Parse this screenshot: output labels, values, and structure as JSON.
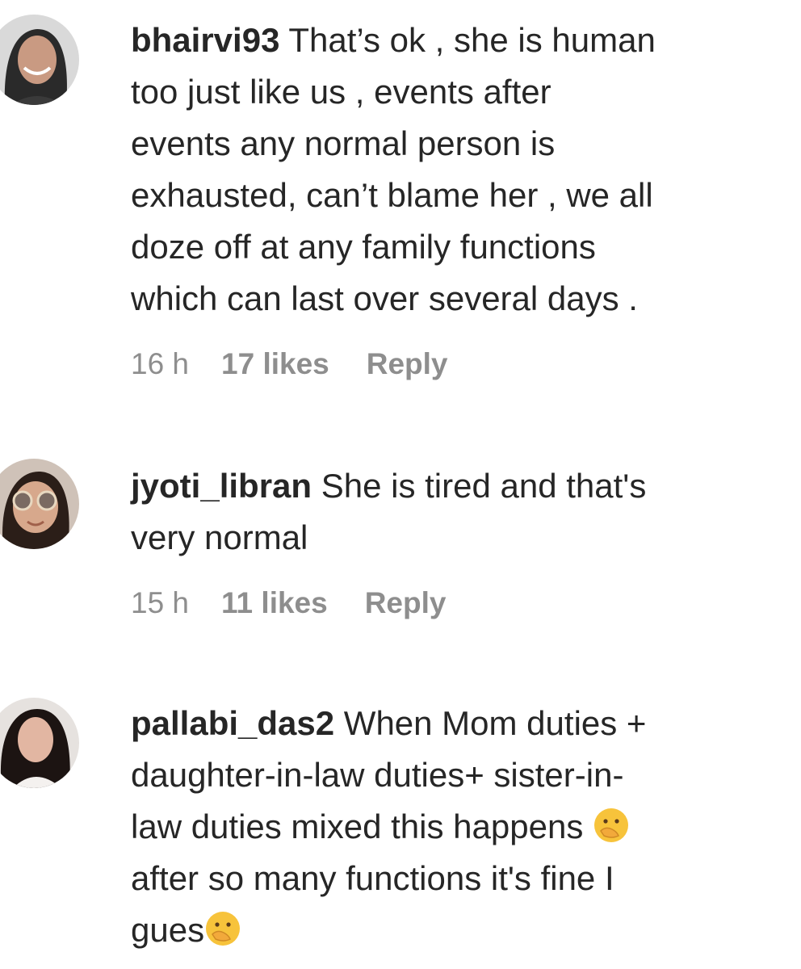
{
  "comments": [
    {
      "username": "bhairvi93",
      "lines": [
        "That’s ok , she is human",
        "too just like us , events after",
        "events any normal person is",
        "exhausted, can’t blame her , we all",
        "doze off at any family functions",
        "which can last over several days ."
      ],
      "time": "16 h",
      "likes": "17 likes",
      "reply": "Reply",
      "avatar_icon": "avatar-photo-woman-smiling"
    },
    {
      "username": "jyoti_libran",
      "lines": [
        "She is tired and that's",
        "very normal"
      ],
      "time": "15 h",
      "likes": "11 likes",
      "reply": "Reply",
      "avatar_icon": "avatar-photo-woman-sunglasses"
    },
    {
      "username": "pallabi_das2",
      "lines": [
        "When Mom duties +",
        "daughter-in-law duties+ sister-in-",
        "law duties mixed this happens ",
        "after so many functions it's fine I",
        "gues"
      ],
      "emoji": "face-with-hand-over-mouth-emoji",
      "avatar_icon": "avatar-photo-woman-dark-hair"
    }
  ],
  "colors": {
    "text": "#262626",
    "meta": "#8e8e8e",
    "background": "#ffffff",
    "emoji": "#f7c33b"
  }
}
